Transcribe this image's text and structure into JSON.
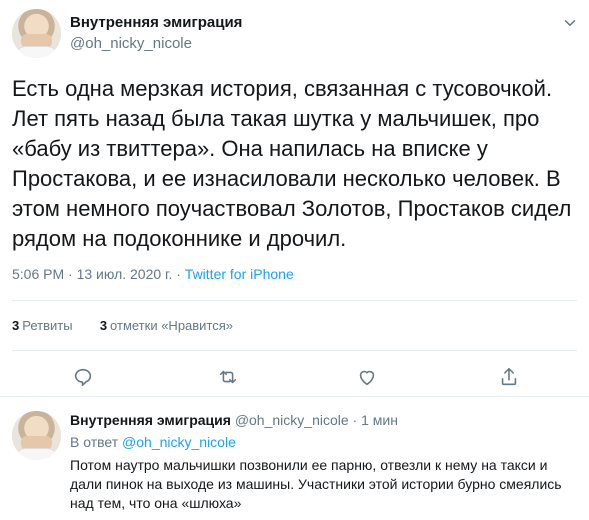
{
  "tweet": {
    "author_name": "Внутренняя эмиграция",
    "author_handle": "@oh_nicky_nicole",
    "text": "Есть одна мерзкая история, связанная с тусовочкой. Лет пять назад была такая шутка у мальчишек, про «бабу из твиттера». Она напилась на вписке у Простакова, и ее изнасиловали несколько человек. В этом немного поучаствовал Золотов, Простаков сидел рядом на подоконнике и дрочил.",
    "time": "5:06 PM",
    "sep": "·",
    "date": "13 июл. 2020 г.",
    "source": "Twitter for iPhone",
    "retweets_count": "3",
    "retweets_label": "Ретвиты",
    "likes_count": "3",
    "likes_label": "отметки «Нравится»"
  },
  "reply": {
    "author_name": "Внутренняя эмиграция",
    "author_handle": "@oh_nicky_nicole",
    "sep": "·",
    "time_ago": "1 мин",
    "reply_to_label": "В ответ",
    "reply_to_handle": "@oh_nicky_nicole",
    "text": "Потом наутро мальчишки позвонили ее парню, отвезли к нему на такси и дали пинок на выходе из машины. Участники этой истории бурно смеялись над тем, что она «шлюха»"
  },
  "icons": {
    "menu": "chevron-down-icon",
    "reply": "reply-icon",
    "retweet": "retweet-icon",
    "like": "heart-icon",
    "share": "share-icon"
  },
  "colors": {
    "text": "#14171a",
    "muted": "#657786",
    "accent": "#1da1f2",
    "divider": "#e6ecf0"
  }
}
